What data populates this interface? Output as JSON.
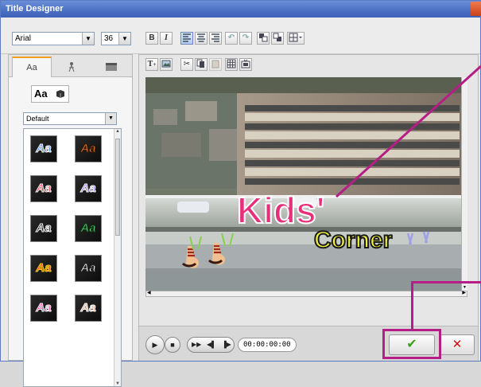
{
  "window": {
    "title": "Title Designer"
  },
  "font": {
    "family": "Arial",
    "size": "36"
  },
  "format_buttons": [
    "B",
    "I"
  ],
  "left_panel": {
    "tabs": [
      {
        "label": "Aa",
        "icon": "font-aa-icon"
      },
      {
        "label": "",
        "icon": "particle-icon"
      },
      {
        "label": "",
        "icon": "background-icon"
      }
    ],
    "mode_label": "Aa",
    "style_select": "Default",
    "styles": [
      {
        "text": "Aa",
        "color": "#3a78e6",
        "stroke": "#ffffff"
      },
      {
        "text": "Aa",
        "color": "#f07a2a",
        "stroke": "#3a1a00"
      },
      {
        "text": "Aa",
        "color": "#e82030",
        "stroke": "#ffffff"
      },
      {
        "text": "Aa",
        "color": "#8a6af0",
        "stroke": "#ffffff"
      },
      {
        "text": "Aa",
        "color": "#111111",
        "stroke": "#ffffff"
      },
      {
        "text": "Aa",
        "color": "#5ed080",
        "stroke": "#0a3a10"
      },
      {
        "text": "Aa",
        "color": "#f04020",
        "stroke": "#f0d020"
      },
      {
        "text": "Aa",
        "color": "#ffffff",
        "stroke": "#222222"
      },
      {
        "text": "Aa",
        "color": "#e83a9a",
        "stroke": "#ffffff"
      },
      {
        "text": "Aa",
        "color": "#e0a080",
        "stroke": "#ffffff"
      }
    ]
  },
  "preview": {
    "title_main": "Kids'",
    "title_sub": "Corner",
    "title_main_color": "#e8307a",
    "title_sub_color": "#f0f040"
  },
  "playback": {
    "timecode": "00:00:00:00",
    "buttons": [
      "play",
      "stop",
      "fast-forward",
      "previous-frame",
      "next-frame"
    ]
  },
  "actions": {
    "ok": "✔",
    "cancel": "✕"
  },
  "annotation_color": "#b51e86"
}
